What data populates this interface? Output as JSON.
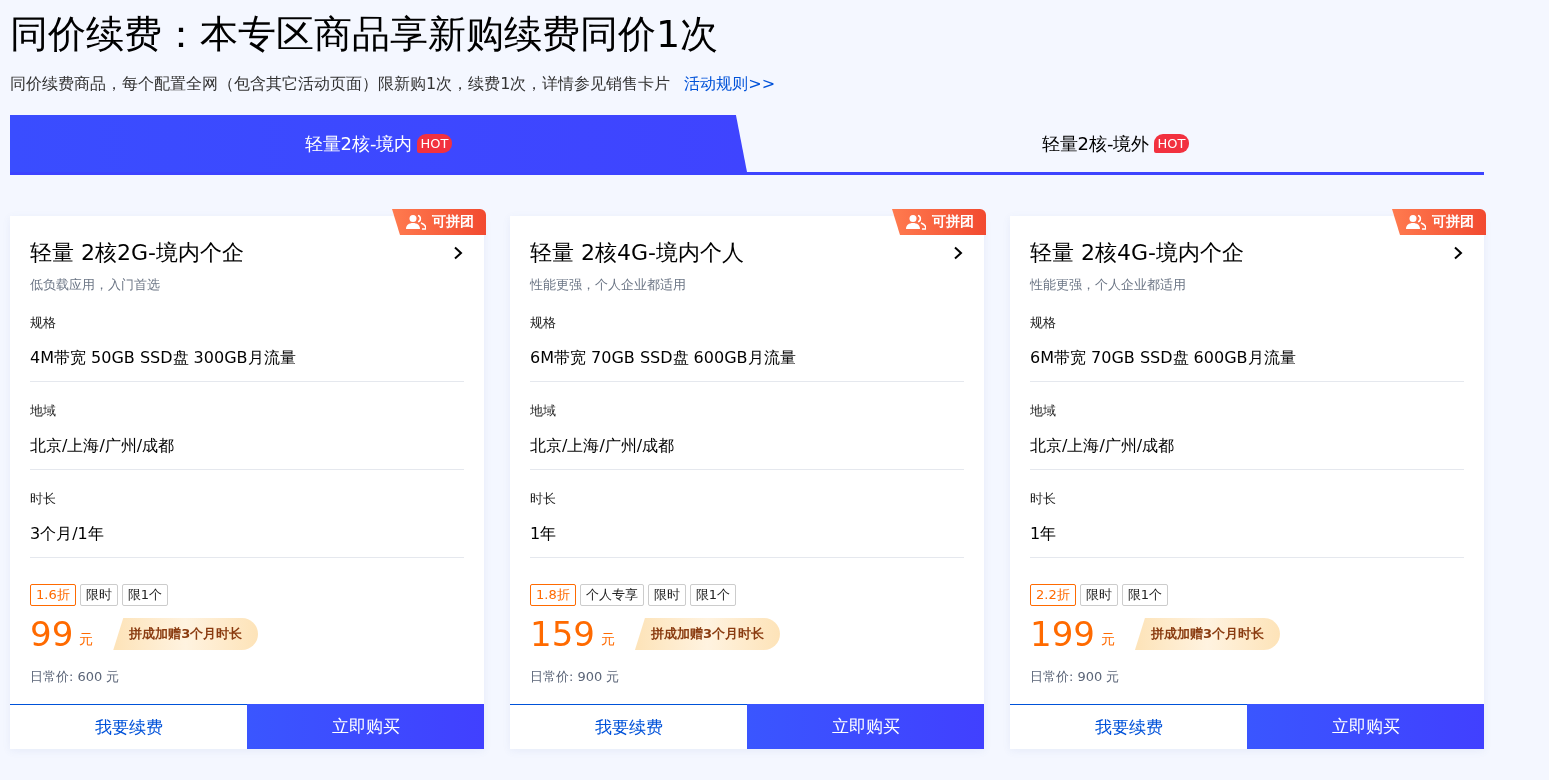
{
  "header": {
    "title": "同价续费：本专区商品享新购续费同价1次",
    "subtitle": "同价续费商品，每个配置全网（包含其它活动页面）限新购1次，续费1次，详情参见销售卡片",
    "rules_link": "活动规则>>"
  },
  "tabs": [
    {
      "label": "轻量2核-境内",
      "badge": "HOT",
      "selected": true
    },
    {
      "label": "轻量2核-境外",
      "badge": "HOT",
      "selected": false
    }
  ],
  "cards": [
    {
      "ribbon": "可拼团",
      "title": "轻量 2核2G-境内个企",
      "desc": "低负载应用，入门首选",
      "specs": [
        {
          "label": "规格",
          "value": "4M带宽 50GB SSD盘 300GB月流量"
        },
        {
          "label": "地域",
          "value": "北京/上海/广州/成都"
        },
        {
          "label": "时长",
          "value": "3个月/1年"
        }
      ],
      "tags": [
        {
          "kind": "discount",
          "text": "1.6折"
        },
        {
          "kind": "plain",
          "text": "限时"
        },
        {
          "kind": "plain",
          "text": "限1个"
        }
      ],
      "price": "99",
      "unit": "元",
      "promo": "拼成加赠3个月时长",
      "regular": "日常价: 600 元",
      "renew": "我要续费",
      "buy": "立即购买"
    },
    {
      "ribbon": "可拼团",
      "title": "轻量 2核4G-境内个人",
      "desc": "性能更强，个人企业都适用",
      "specs": [
        {
          "label": "规格",
          "value": "6M带宽 70GB SSD盘 600GB月流量"
        },
        {
          "label": "地域",
          "value": "北京/上海/广州/成都"
        },
        {
          "label": "时长",
          "value": "1年"
        }
      ],
      "tags": [
        {
          "kind": "discount",
          "text": "1.8折"
        },
        {
          "kind": "plain",
          "text": "个人专享"
        },
        {
          "kind": "plain",
          "text": "限时"
        },
        {
          "kind": "plain",
          "text": "限1个"
        }
      ],
      "price": "159",
      "unit": "元",
      "promo": "拼成加赠3个月时长",
      "regular": "日常价: 900 元",
      "renew": "我要续费",
      "buy": "立即购买"
    },
    {
      "ribbon": "可拼团",
      "title": "轻量 2核4G-境内个企",
      "desc": "性能更强，个人企业都适用",
      "specs": [
        {
          "label": "规格",
          "value": "6M带宽 70GB SSD盘 600GB月流量"
        },
        {
          "label": "地域",
          "value": "北京/上海/广州/成都"
        },
        {
          "label": "时长",
          "value": "1年"
        }
      ],
      "tags": [
        {
          "kind": "discount",
          "text": "2.2折"
        },
        {
          "kind": "plain",
          "text": "限时"
        },
        {
          "kind": "plain",
          "text": "限1个"
        }
      ],
      "price": "199",
      "unit": "元",
      "promo": "拼成加赠3个月时长",
      "regular": "日常价: 900 元",
      "renew": "我要续费",
      "buy": "立即购买"
    }
  ]
}
